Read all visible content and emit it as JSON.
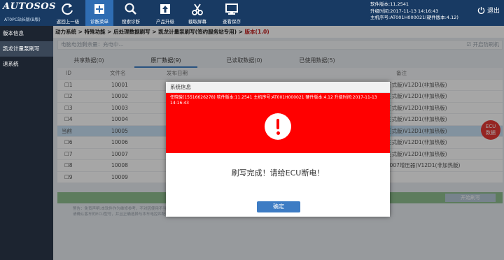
{
  "header": {
    "logo": "AUTOSOS",
    "subtitle": "AT0PC站长版(B版)",
    "toolbar": [
      {
        "label": "返回上一级",
        "icon": "refresh-icon"
      },
      {
        "label": "诊断菜单",
        "icon": "plus-icon"
      },
      {
        "label": "搜索诊断",
        "icon": "search-icon"
      },
      {
        "label": "产品升级",
        "icon": "upload-icon"
      },
      {
        "label": "截取屏幕",
        "icon": "scissors-icon"
      },
      {
        "label": "查看保存",
        "icon": "monitor-icon"
      }
    ],
    "sysinfo": {
      "software": "软件版本:11.2541",
      "upgrade_time": "升级时间:2017-11-13 14:16:43",
      "host_serial": "主机序号:AT001H000021(硬件版本:4.12)"
    },
    "exit_label": "退出"
  },
  "sidebar": {
    "items": [
      {
        "label": "版本信息"
      },
      {
        "label": "凯龙计量泵刷写"
      },
      {
        "label": "退系统"
      }
    ]
  },
  "breadcrumb": {
    "parts": [
      "动力系统",
      "特殊功能",
      "后处理数据刷写",
      "凯龙计量泵刷写(签约服务站专用)"
    ],
    "current": "版本(1.0)",
    "sep": ">"
  },
  "tipbar": {
    "text": "电脑电池剩余量：充电中...",
    "flash": "开启防刷机"
  },
  "tabs": [
    "共享数据(0)",
    "原厂数据(9)",
    "已读取数据(0)",
    "已使用数据(5)"
  ],
  "table": {
    "headers": [
      "ID",
      "文件名",
      "发布日期",
      "备注"
    ],
    "rows": [
      {
        "id": "1",
        "file": "10001",
        "note": "正式版)V12D1(非加热版)"
      },
      {
        "id": "2",
        "file": "10002",
        "note": "正式版)V12D1(非加热版)"
      },
      {
        "id": "3",
        "file": "10003",
        "note": "正式版)V12D1(非加热版)"
      },
      {
        "id": "4",
        "file": "10004",
        "note": "正式版)V12D1(非加热版)"
      },
      {
        "id": "当前",
        "file": "10005",
        "note": "正式版)V12D1(非加热版)"
      },
      {
        "id": "6",
        "file": "10006",
        "note": "正式版)V12D1(非加热版)"
      },
      {
        "id": "7",
        "file": "10007",
        "note": "正式版)V12D1(非加热版)"
      },
      {
        "id": "8",
        "file": "10008",
        "note": "T007增压器)V12D1(非加热版)"
      },
      {
        "id": "9",
        "file": "10009",
        "note": ""
      }
    ]
  },
  "start_button": "开始刷写",
  "notes": [
    "警告：免责声明:本软件作为维修参考，不对因使用不当造成的车辆损坏承担责任，请谨慎操作。",
    "请确认客车的ECU型号，并且正确选择与本车电控匹配的数据，否则会导致ECU刷写报错，刷写的时候，一定不要断电，不要拔出诊断。"
  ],
  "ecu_badge": [
    "ECU",
    "数据"
  ],
  "modal": {
    "title": "系统信息",
    "info": "任晓骏(15516626278) 软件版本:11.2541 主机序号:AT001H000021 硬件版本:4.12 升级时间:2017-11-13 14:16:43",
    "message": "刷写完成！请给ECU断电！",
    "ok": "确定"
  }
}
